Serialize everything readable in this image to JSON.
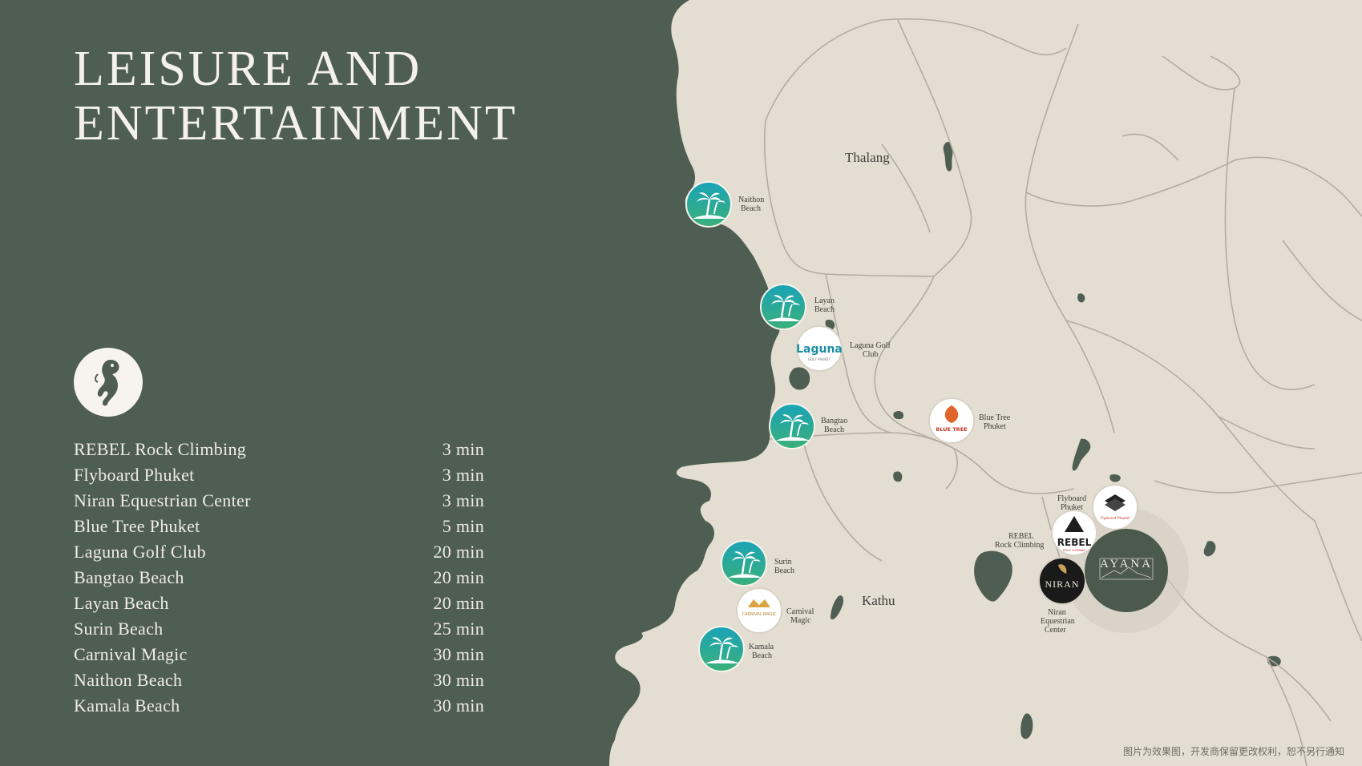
{
  "title": "LEISURE AND\nENTERTAINMENT",
  "brand_icon": "seahorse-icon",
  "destinations": [
    {
      "name": "REBEL Rock Climbing",
      "time": "3 min"
    },
    {
      "name": "Flyboard Phuket",
      "time": "3 min"
    },
    {
      "name": "Niran Equestrian Center",
      "time": "3 min"
    },
    {
      "name": "Blue Tree Phuket",
      "time": "5 min"
    },
    {
      "name": "Laguna Golf Club",
      "time": "20 min"
    },
    {
      "name": "Bangtao Beach",
      "time": "20 min"
    },
    {
      "name": "Layan Beach",
      "time": "20 min"
    },
    {
      "name": "Surin Beach",
      "time": "25 min"
    },
    {
      "name": "Carnival Magic",
      "time": "30 min"
    },
    {
      "name": "Naithon Beach",
      "time": "30 min"
    },
    {
      "name": "Kamala Beach",
      "time": "30 min"
    }
  ],
  "map": {
    "areas": {
      "thalang": "Thalang",
      "kathu": "Kathu"
    },
    "pois": {
      "naithon": {
        "line1": "Naithon",
        "line2": "Beach",
        "icon": "palm-tree-icon"
      },
      "layan": {
        "line1": "Layan",
        "line2": "Beach",
        "icon": "palm-tree-icon"
      },
      "laguna": {
        "line1": "Laguna Golf",
        "line2": "Club",
        "logo": "Laguna",
        "logo_sub": "GOLF PHUKET"
      },
      "bangtao": {
        "line1": "Bangtao",
        "line2": "Beach",
        "icon": "palm-tree-icon"
      },
      "bluetree": {
        "line1": "Blue Tree",
        "line2": "Phuket",
        "logo": "BLUE TREE"
      },
      "surin": {
        "line1": "Surin",
        "line2": "Beach",
        "icon": "palm-tree-icon"
      },
      "carnival": {
        "line1": "Carnival",
        "line2": "Magic",
        "logo": "CARNIVAL MAGIC"
      },
      "kamala": {
        "line1": "Kamala",
        "line2": "Beach",
        "icon": "palm-tree-icon"
      },
      "flyboard": {
        "line1": "Flyboard",
        "line2": "Phuket",
        "logo": "Flyboard Phuket"
      },
      "rebel": {
        "line1": "REBEL",
        "line2": "Rock Climbing",
        "logo": "REBEL",
        "logo_sub": "ROCK CLIMBING"
      },
      "niran": {
        "line1": "Niran",
        "line2": "Equestrian",
        "line3": "Center",
        "logo": "NIRAN"
      },
      "ayana": {
        "logo": "AYANA"
      }
    }
  },
  "footer_note": "图片为效果图，开发商保留更改权利，恕不另行通知",
  "colors": {
    "background": "#4f5e52",
    "land": "#e4ddd1",
    "beach_marker": "#1f9e8e",
    "ayana": "#4b5a4d"
  }
}
